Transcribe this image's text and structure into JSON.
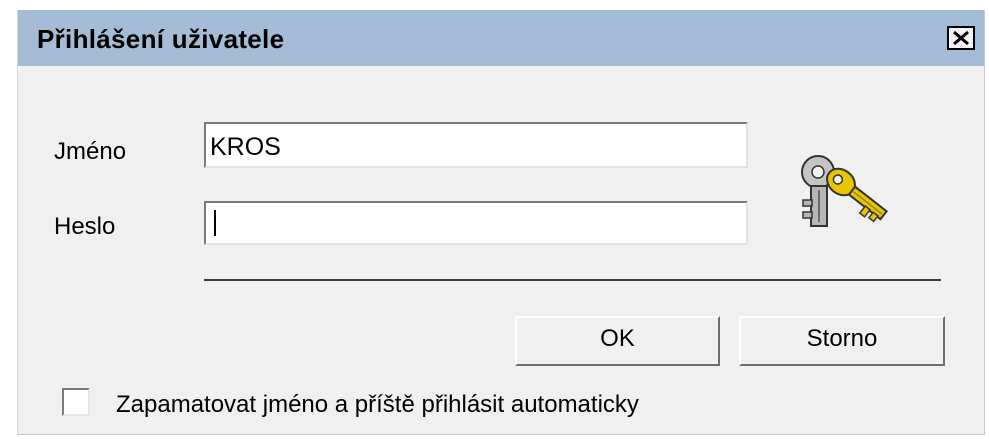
{
  "dialog": {
    "title": "Přihlášení uživatele",
    "close_icon": "close-x-icon"
  },
  "form": {
    "name_label": "Jméno",
    "name_value": "KROS",
    "password_label": "Heslo",
    "password_value": "",
    "key_icon": "keys-icon"
  },
  "buttons": {
    "ok_label": "OK",
    "cancel_label": "Storno"
  },
  "remember": {
    "label": "Zapamatovat jméno a příště přihlásit automaticky",
    "checked": false
  },
  "colors": {
    "titlebar": "#a4bcd6",
    "dialog_background": "#f0f0f0",
    "key_gold": "#e8c600",
    "key_grey": "#bfbfbf"
  }
}
